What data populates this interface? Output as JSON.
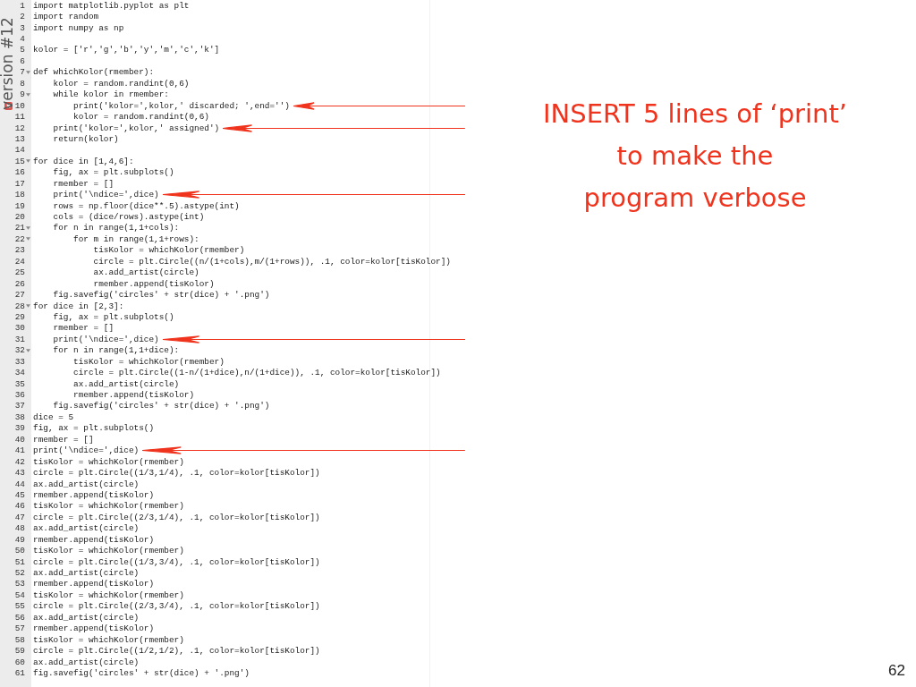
{
  "slide": {
    "side_label": "version #12",
    "page_number": "62"
  },
  "editor": {
    "lines": [
      {
        "number": "1",
        "text": "import matplotlib.pyplot as plt",
        "fold": false,
        "error": false,
        "arrow": false
      },
      {
        "number": "2",
        "text": "import random",
        "fold": false,
        "error": false,
        "arrow": false
      },
      {
        "number": "3",
        "text": "import numpy as np",
        "fold": false,
        "error": false,
        "arrow": false
      },
      {
        "number": "4",
        "fold": false,
        "error": false,
        "arrow": false
      },
      {
        "number": "5",
        "text": "kolor = ['r','g','b','y','m','c','k']",
        "fold": false,
        "error": false,
        "arrow": false
      },
      {
        "number": "6",
        "fold": false,
        "error": false,
        "arrow": false
      },
      {
        "number": "7",
        "text": "def whichKolor(rmember):",
        "fold": true,
        "error": false,
        "arrow": false
      },
      {
        "number": "8",
        "text": "    kolor = random.randint(0,6)",
        "fold": false,
        "error": false,
        "arrow": false
      },
      {
        "number": "9",
        "text": "    while kolor in rmember:",
        "fold": true,
        "error": false,
        "arrow": false
      },
      {
        "number": "10",
        "text": "        print('kolor=',kolor,' discarded; ',end='')",
        "fold": false,
        "error": true,
        "arrow": true
      },
      {
        "number": "11",
        "text": "        kolor = random.randint(0,6)",
        "fold": false,
        "error": false,
        "arrow": false
      },
      {
        "number": "12",
        "text": "    print('kolor=',kolor,' assigned')",
        "fold": false,
        "error": false,
        "arrow": true
      },
      {
        "number": "13",
        "text": "    return(kolor)",
        "fold": false,
        "error": false,
        "arrow": false
      },
      {
        "number": "14",
        "fold": false,
        "error": false,
        "arrow": false
      },
      {
        "number": "15",
        "text": "for dice in [1,4,6]:",
        "fold": true,
        "error": false,
        "arrow": false
      },
      {
        "number": "16",
        "text": "    fig, ax = plt.subplots()",
        "fold": false,
        "error": false,
        "arrow": false
      },
      {
        "number": "17",
        "text": "    rmember = []",
        "fold": false,
        "error": false,
        "arrow": false
      },
      {
        "number": "18",
        "text": "    print('\\ndice=',dice)",
        "fold": false,
        "error": false,
        "arrow": true
      },
      {
        "number": "19",
        "text": "    rows = np.floor(dice**.5).astype(int)",
        "fold": false,
        "error": false,
        "arrow": false
      },
      {
        "number": "20",
        "text": "    cols = (dice/rows).astype(int)",
        "fold": false,
        "error": false,
        "arrow": false
      },
      {
        "number": "21",
        "text": "    for n in range(1,1+cols):",
        "fold": true,
        "error": false,
        "arrow": false
      },
      {
        "number": "22",
        "text": "        for m in range(1,1+rows):",
        "fold": true,
        "error": false,
        "arrow": false
      },
      {
        "number": "23",
        "text": "            tisKolor = whichKolor(rmember)",
        "fold": false,
        "error": false,
        "arrow": false
      },
      {
        "number": "24",
        "text": "            circle = plt.Circle((n/(1+cols),m/(1+rows)), .1, color=kolor[tisKolor])",
        "fold": false,
        "error": false,
        "arrow": false
      },
      {
        "number": "25",
        "text": "            ax.add_artist(circle)",
        "fold": false,
        "error": false,
        "arrow": false
      },
      {
        "number": "26",
        "text": "            rmember.append(tisKolor)",
        "fold": false,
        "error": false,
        "arrow": false
      },
      {
        "number": "27",
        "text": "    fig.savefig('circles' + str(dice) + '.png')",
        "fold": false,
        "error": false,
        "arrow": false
      },
      {
        "number": "28",
        "text": "for dice in [2,3]:",
        "fold": true,
        "error": false,
        "arrow": false
      },
      {
        "number": "29",
        "text": "    fig, ax = plt.subplots()",
        "fold": false,
        "error": false,
        "arrow": false
      },
      {
        "number": "30",
        "text": "    rmember = []",
        "fold": false,
        "error": false,
        "arrow": false
      },
      {
        "number": "31",
        "text": "    print('\\ndice=',dice)",
        "fold": false,
        "error": false,
        "arrow": true
      },
      {
        "number": "32",
        "text": "    for n in range(1,1+dice):",
        "fold": true,
        "error": false,
        "arrow": false
      },
      {
        "number": "33",
        "text": "        tisKolor = whichKolor(rmember)",
        "fold": false,
        "error": false,
        "arrow": false
      },
      {
        "number": "34",
        "text": "        circle = plt.Circle((1-n/(1+dice),n/(1+dice)), .1, color=kolor[tisKolor])",
        "fold": false,
        "error": false,
        "arrow": false
      },
      {
        "number": "35",
        "text": "        ax.add_artist(circle)",
        "fold": false,
        "error": false,
        "arrow": false
      },
      {
        "number": "36",
        "text": "        rmember.append(tisKolor)",
        "fold": false,
        "error": false,
        "arrow": false
      },
      {
        "number": "37",
        "text": "    fig.savefig('circles' + str(dice) + '.png')",
        "fold": false,
        "error": false,
        "arrow": false
      },
      {
        "number": "38",
        "text": "dice = 5",
        "fold": false,
        "error": false,
        "arrow": false
      },
      {
        "number": "39",
        "text": "fig, ax = plt.subplots()",
        "fold": false,
        "error": false,
        "arrow": false
      },
      {
        "number": "40",
        "text": "rmember = []",
        "fold": false,
        "error": false,
        "arrow": false
      },
      {
        "number": "41",
        "text": "print('\\ndice=',dice)",
        "fold": false,
        "error": false,
        "arrow": true
      },
      {
        "number": "42",
        "text": "tisKolor = whichKolor(rmember)",
        "fold": false,
        "error": false,
        "arrow": false
      },
      {
        "number": "43",
        "text": "circle = plt.Circle((1/3,1/4), .1, color=kolor[tisKolor])",
        "fold": false,
        "error": false,
        "arrow": false
      },
      {
        "number": "44",
        "text": "ax.add_artist(circle)",
        "fold": false,
        "error": false,
        "arrow": false
      },
      {
        "number": "45",
        "text": "rmember.append(tisKolor)",
        "fold": false,
        "error": false,
        "arrow": false
      },
      {
        "number": "46",
        "text": "tisKolor = whichKolor(rmember)",
        "fold": false,
        "error": false,
        "arrow": false
      },
      {
        "number": "47",
        "text": "circle = plt.Circle((2/3,1/4), .1, color=kolor[tisKolor])",
        "fold": false,
        "error": false,
        "arrow": false
      },
      {
        "number": "48",
        "text": "ax.add_artist(circle)",
        "fold": false,
        "error": false,
        "arrow": false
      },
      {
        "number": "49",
        "text": "rmember.append(tisKolor)",
        "fold": false,
        "error": false,
        "arrow": false
      },
      {
        "number": "50",
        "text": "tisKolor = whichKolor(rmember)",
        "fold": false,
        "error": false,
        "arrow": false
      },
      {
        "number": "51",
        "text": "circle = plt.Circle((1/3,3/4), .1, color=kolor[tisKolor])",
        "fold": false,
        "error": false,
        "arrow": false
      },
      {
        "number": "52",
        "text": "ax.add_artist(circle)",
        "fold": false,
        "error": false,
        "arrow": false
      },
      {
        "number": "53",
        "text": "rmember.append(tisKolor)",
        "fold": false,
        "error": false,
        "arrow": false
      },
      {
        "number": "54",
        "text": "tisKolor = whichKolor(rmember)",
        "fold": false,
        "error": false,
        "arrow": false
      },
      {
        "number": "55",
        "text": "circle = plt.Circle((2/3,3/4), .1, color=kolor[tisKolor])",
        "fold": false,
        "error": false,
        "arrow": false
      },
      {
        "number": "56",
        "text": "ax.add_artist(circle)",
        "fold": false,
        "error": false,
        "arrow": false
      },
      {
        "number": "57",
        "text": "rmember.append(tisKolor)",
        "fold": false,
        "error": false,
        "arrow": false
      },
      {
        "number": "58",
        "text": "tisKolor = whichKolor(rmember)",
        "fold": false,
        "error": false,
        "arrow": false
      },
      {
        "number": "59",
        "text": "circle = plt.Circle((1/2,1/2), .1, color=kolor[tisKolor])",
        "fold": false,
        "error": false,
        "arrow": false
      },
      {
        "number": "60",
        "text": "ax.add_artist(circle)",
        "fold": false,
        "error": false,
        "arrow": false
      },
      {
        "number": "61",
        "text": "fig.savefig('circles' + str(dice) + '.png')",
        "fold": false,
        "error": false,
        "arrow": false
      }
    ]
  },
  "note": {
    "lines": [
      "INSERT 5 lines of ‘print’",
      "to make the",
      "program verbose"
    ]
  }
}
